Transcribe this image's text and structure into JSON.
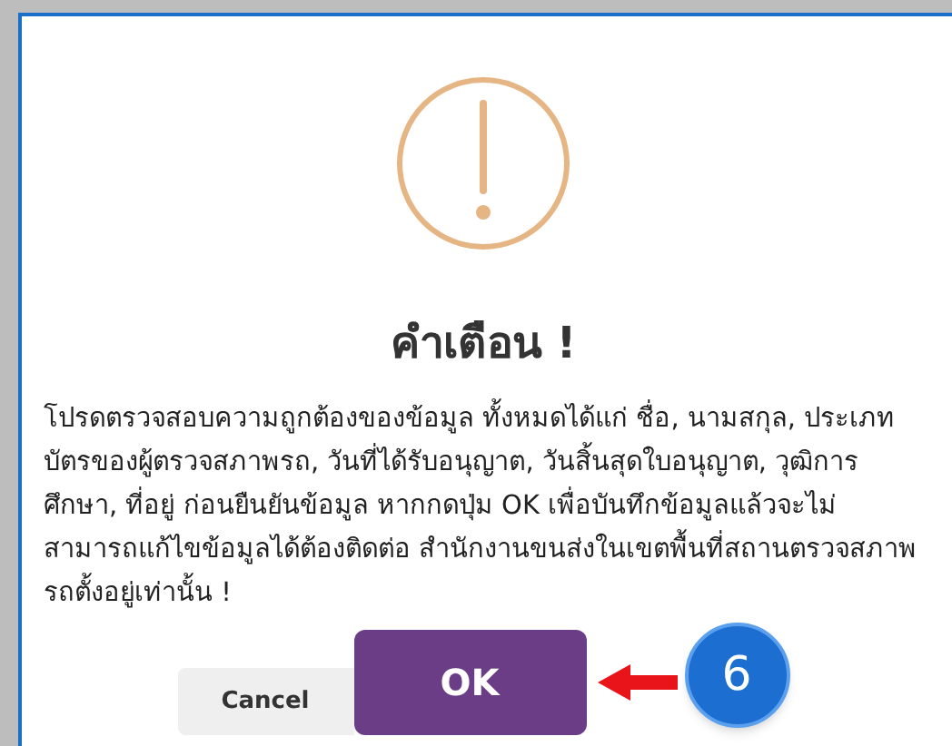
{
  "dialog": {
    "title": "คำเตือน !",
    "message": "โปรดตรวจสอบความถูกต้องของข้อมูล ทั้งหมดได้แก่ ชื่อ, นามสกุล, ประเภทบัตรของผู้ตรวจสภาพรถ, วันที่ได้รับอนุญาต, วันสิ้นสุดใบอนุญาต, วุฒิการศึกษา, ที่อยู่ ก่อนยืนยันข้อมูล หากกดปุ่ม OK เพื่อบันทึกข้อมูลแล้วจะไม่สามารถแก้ไขข้อมูลได้ต้องติดต่อ สำนักงานขนส่งในเขตพื้นที่สถานตรวจสภาพรถตั้งอยู่เท่านั้น !",
    "buttons": [
      {
        "kind": "secondary",
        "label": "Cancel"
      },
      {
        "kind": "primary",
        "label": "OK"
      }
    ]
  },
  "step_badge": "6"
}
